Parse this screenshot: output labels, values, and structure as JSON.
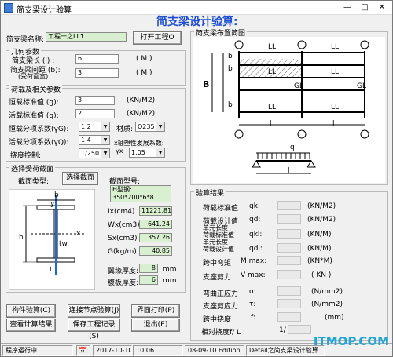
{
  "window": {
    "title": "简支梁设计验算",
    "main_heading": "简支梁设计验算:"
  },
  "beam_name": {
    "label": "简支梁名称:",
    "value": "工程一之LL1"
  },
  "open_project_button": "打开工程O",
  "geometry": {
    "title": "几何参数",
    "span_label": "简支梁长 (l) :",
    "span_value": "6",
    "span_unit": "( M )",
    "spacing_label": "简支梁间距 (b):",
    "spacing_note": "(受荷面宽)",
    "spacing_value": "3",
    "spacing_unit": "( M )"
  },
  "loads": {
    "title": "荷载及相关参数",
    "dead_label": "恒载标准值 (g):",
    "dead_value": "3",
    "dead_unit": "(KN/M2)",
    "live_label": "活载标准值 (q):",
    "live_value": "2",
    "live_unit": "(KN/M2)",
    "dead_factor_label": "恒载分项系数(γG):",
    "dead_factor_value": "1.2",
    "material_label": "材质:",
    "material_value": "Q235",
    "live_factor_label": "活载分项系数(γQ):",
    "live_factor_value": "1.4",
    "plastic_label": "x轴塑性发展系数:",
    "plastic_sym": "γx",
    "plastic_value": "1.05",
    "deflection_label": "挠度控制:",
    "deflection_value": "1/250"
  },
  "section": {
    "title": "选择受荷截面",
    "type_label": "截面类型:",
    "select_button": "选择截面",
    "model_label": "截面型号:",
    "model_value": "H型钢:\n350*200*6*8",
    "ix_label": "Ix(cm4)",
    "ix_value": "11221.81",
    "wx_label": "Wx(cm3)",
    "wx_value": "641.24",
    "sx_label": "Sx(cm3)",
    "sx_value": "357.26",
    "g_label": "G(kg/m)",
    "g_value": "40.85",
    "flange_label": "翼缘厚度:",
    "flange_value": "8",
    "flange_unit": "mm",
    "web_label": "腹板厚度:",
    "web_value": "6",
    "web_unit": "mm",
    "dim_b": "b",
    "dim_y": "y",
    "dim_x": "x",
    "dim_tw": "tw",
    "dim_h": "h",
    "dim_t": "t"
  },
  "layout_diagram": {
    "title": "简支梁布置简图",
    "ll_label": "LL",
    "gl_label": "GL",
    "b_label": "b",
    "B_label": "B",
    "l_label": "l",
    "q_label": "q"
  },
  "results": {
    "title": "验算结果",
    "rows": [
      {
        "label": "荷载标准值",
        "sym": "qk:",
        "unit": "(KN/M2)"
      },
      {
        "label": "荷载设计值",
        "sym": "qd:",
        "unit": "(KN/M2)"
      },
      {
        "label": "单元长度\n荷载标准值",
        "sym": "qkl:",
        "unit": "(KN/M)"
      },
      {
        "label": "单元长度\n荷载设计值",
        "sym": "qdl:",
        "unit": "(KN/M)"
      },
      {
        "label": "跨中弯矩",
        "sym": "M max:",
        "unit": "(KN*M)"
      },
      {
        "label": "支座剪力",
        "sym": "V max:",
        "unit": "( KN )"
      },
      {
        "label": "弯曲正应力",
        "sym": "σ:",
        "unit": "(N/mm2)"
      },
      {
        "label": "支座剪应力",
        "sym": "τ:",
        "unit": "(N/mm2)"
      },
      {
        "label": "跨中挠度",
        "sym": "f:",
        "unit": "(mm)"
      }
    ],
    "rel_label": "相对挠度f/ L :",
    "rel_val": "1/"
  },
  "buttons": {
    "calc": "构件验算(C)",
    "node": "连接节点验算(J)",
    "print": "界面打印(P)",
    "view": "查看计算结果",
    "save": "保存工程记录(S)",
    "exit": "退出(E)"
  },
  "status": {
    "running": "程序运行中...",
    "date": "2017-10-10",
    "time": "10:06",
    "edition": "08-09-10 Edition",
    "detail": "Detail之简支梁设计验算"
  },
  "watermark": "ITMOP.COM"
}
